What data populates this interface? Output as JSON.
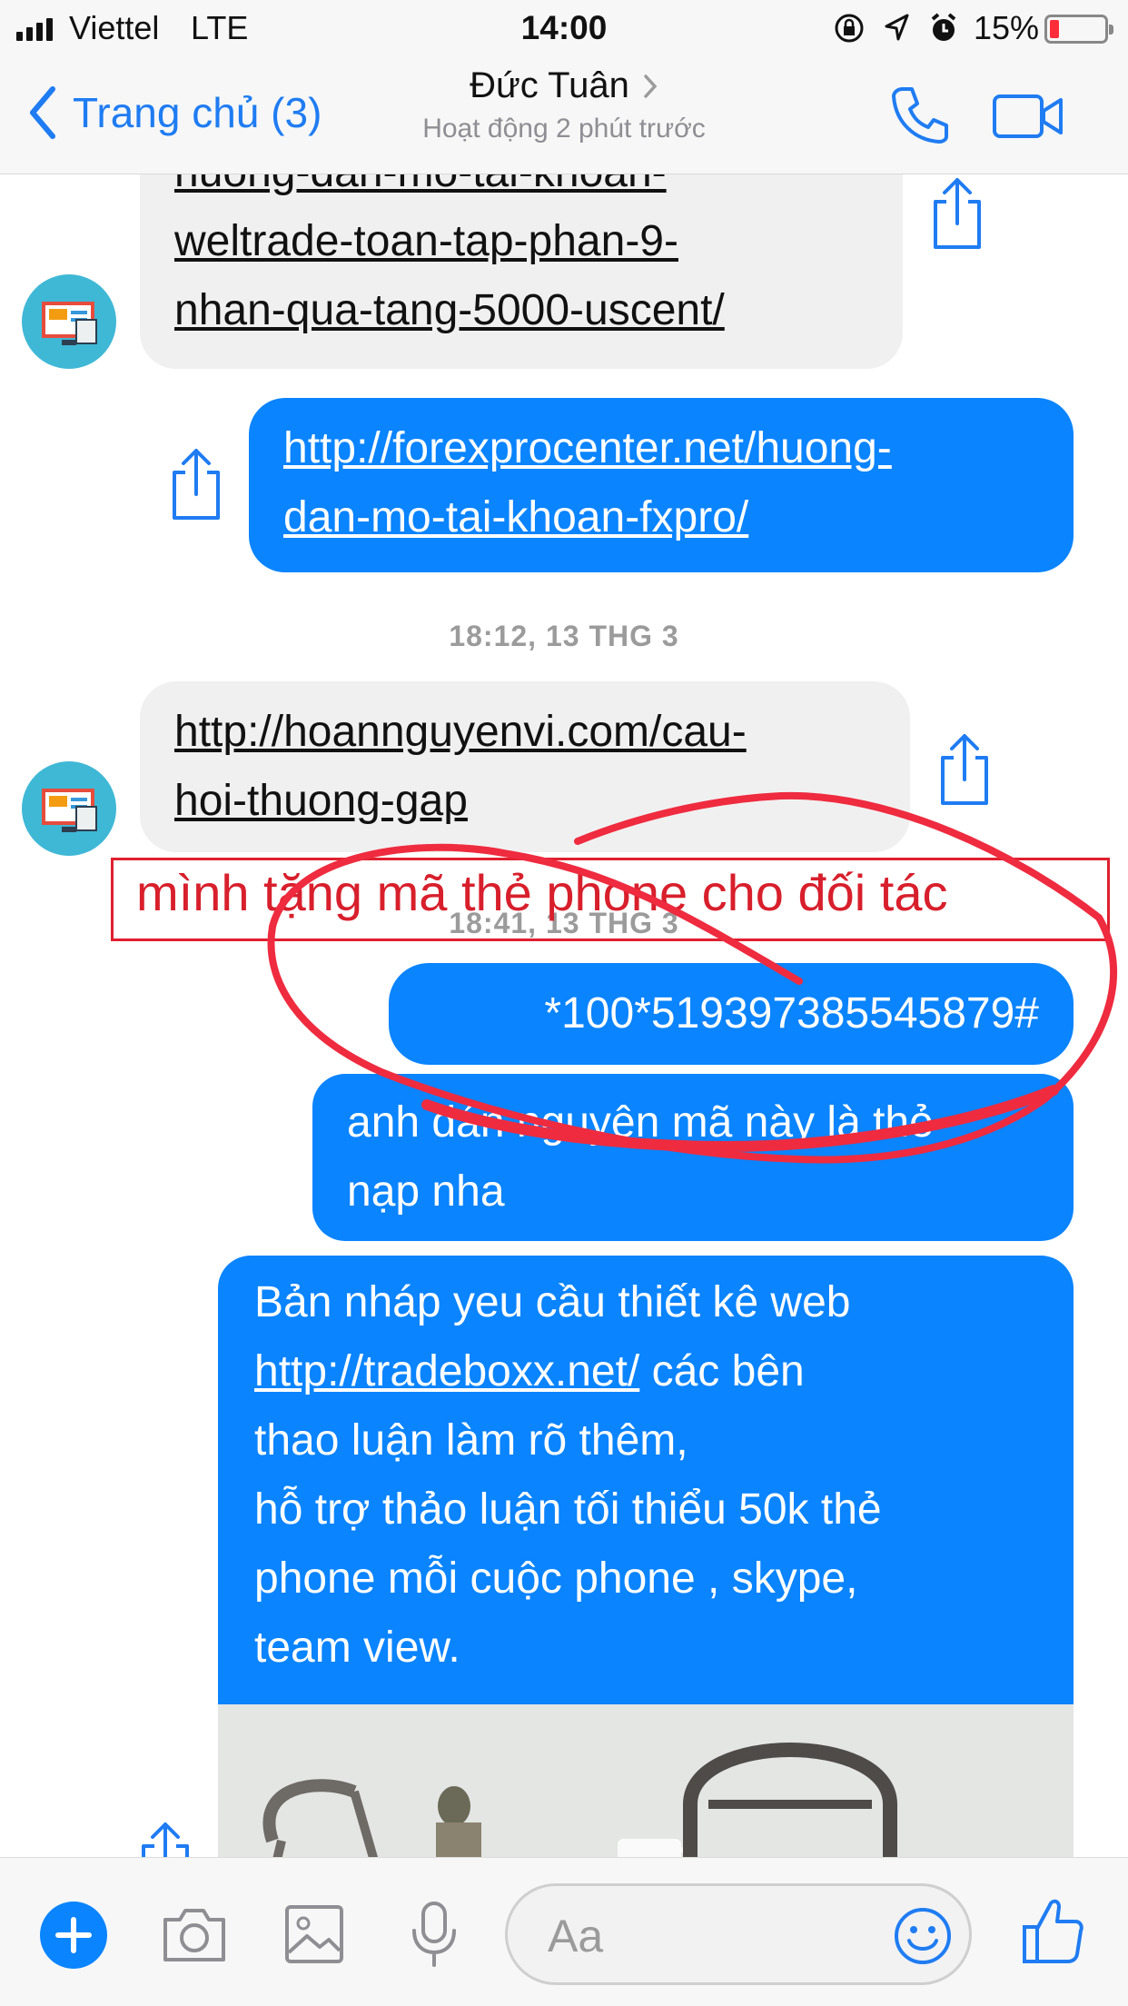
{
  "status_bar": {
    "carrier": "Viettel",
    "network": "LTE",
    "time": "14:00",
    "battery": "15%",
    "icons": [
      "rotation-lock-icon",
      "location-icon",
      "alarm-icon",
      "battery-icon"
    ],
    "battery_level": 0.15
  },
  "nav": {
    "back_label": "Trang chủ (3)",
    "title": "Đức Tuân",
    "subtitle": "Hoạt động 2 phút trước"
  },
  "messages": {
    "m1_line1": "huong-dan-mo-tai-khoan-",
    "m1_line2": "weltrade-toan-tap-phan-9-",
    "m1_line3": "nhan-qua-tang-5000-uscent/",
    "m2_line1": "http://forexprocenter.net/huong-",
    "m2_line2": "dan-mo-tai-khoan-fxpro/",
    "ts1": "18:12, 13 THG 3",
    "m3_line1": "http://hoannguyenvi.com/cau-",
    "m3_line2": "hoi-thuong-gap",
    "ts2": "18:41, 13 THG 3",
    "m4": "*100*519397385545879#",
    "m5_line1": "anh dán nguyên mã này là thẻ",
    "m5_line2": "nạp nha",
    "m6_line1": "Bản nháp yeu cầu thiết kê web",
    "m6_link": "http://tradeboxx.net/",
    "m6_line2_rest": " các bên",
    "m6_line3": "thao luận làm rõ thêm,",
    "m6_line4": "hỗ trợ thảo luận tối thiểu 50k thẻ",
    "m6_line5": "phone mỗi cuộc phone , skype,",
    "m6_line6": "team view."
  },
  "annotation": {
    "text": "mình tặng mã thẻ phone cho đối tác",
    "color": "#e0202f"
  },
  "composer": {
    "placeholder": "Aa"
  },
  "colors": {
    "accent": "#0a84ff",
    "incoming_bubble": "#f1f0f0",
    "avatar": "#3fb8d6"
  }
}
